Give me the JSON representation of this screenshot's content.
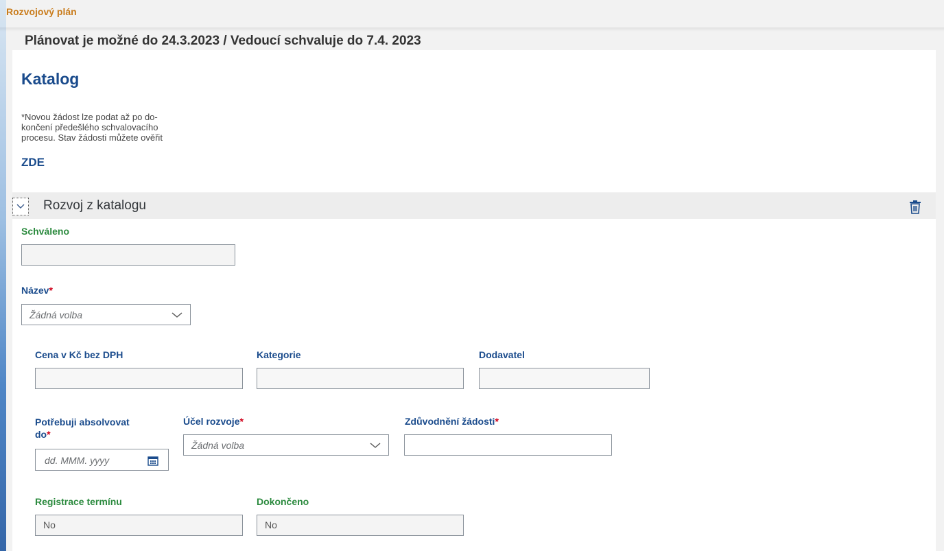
{
  "header": {
    "title": "Rozvojový plán",
    "deadline": "Plánovat je možné do 24.3.2023 / Vedoucí schvaluje do 7.4. 2023"
  },
  "catalog": {
    "title": "Katalog",
    "note_line1": "*Novou žádost lze podat až po do-",
    "note_line2": "končení předešlého schvalovacího",
    "note_line3": "procesu. Stav žádosti můžete ověřit",
    "link": "ZDE"
  },
  "section": {
    "title": "Rozvoj z katalogu"
  },
  "form": {
    "approved": {
      "label": "Schváleno",
      "value": ""
    },
    "name": {
      "label": "Název",
      "required": "*",
      "placeholder": "Žádná volba"
    },
    "price": {
      "label": "Cena v Kč bez DPH",
      "value": ""
    },
    "category": {
      "label": "Kategorie",
      "value": ""
    },
    "supplier": {
      "label": "Dodavatel",
      "value": ""
    },
    "complete_by": {
      "label_line1": "Potřebuji absolvovat",
      "label_line2": "do",
      "required": "*",
      "placeholder": "dd. MMM. yyyy"
    },
    "purpose": {
      "label": "Účel rozvoje",
      "required": "*",
      "placeholder": "Žádná volba"
    },
    "justification": {
      "label": "Zdůvodnění žádosti",
      "required": "*",
      "value": ""
    },
    "registration": {
      "label": "Registrace termínu",
      "value": "No"
    },
    "completed": {
      "label": "Dokončeno",
      "value": "No"
    }
  },
  "colors": {
    "title_orange": "#c97c1c",
    "label_blue": "#1a4b8c",
    "label_green": "#2b8a3e",
    "required_red": "#d0021b"
  },
  "icons": [
    "chevron-down-icon",
    "trash-icon",
    "calendar-icon"
  ]
}
